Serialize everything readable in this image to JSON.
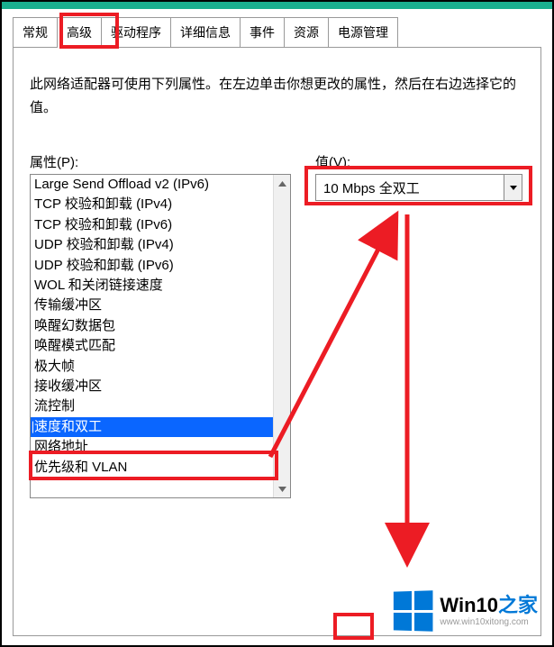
{
  "tabs": {
    "general": "常规",
    "advanced": "高级",
    "driver": "驱动程序",
    "details": "详细信息",
    "events": "事件",
    "resources": "资源",
    "power": "电源管理"
  },
  "description": "此网络适配器可使用下列属性。在左边单击你想更改的属性，然后在右边选择它的值。",
  "labels": {
    "property": "属性(P):",
    "value": "值(V):"
  },
  "property_list": [
    "Large Send Offload v2 (IPv6)",
    "TCP 校验和卸载 (IPv4)",
    "TCP 校验和卸载 (IPv6)",
    "UDP 校验和卸载 (IPv4)",
    "UDP 校验和卸载 (IPv6)",
    "WOL 和关闭链接速度",
    "传输缓冲区",
    "唤醒幻数据包",
    "唤醒模式匹配",
    "极大帧",
    "接收缓冲区",
    "流控制",
    "速度和双工",
    "网络地址",
    "优先级和 VLAN"
  ],
  "selected_index": 12,
  "value_dropdown": "10 Mbps 全双工",
  "watermark": {
    "brand_prefix": "Win10",
    "brand_suffix": "之家",
    "url": "www.win10xitong.com"
  }
}
